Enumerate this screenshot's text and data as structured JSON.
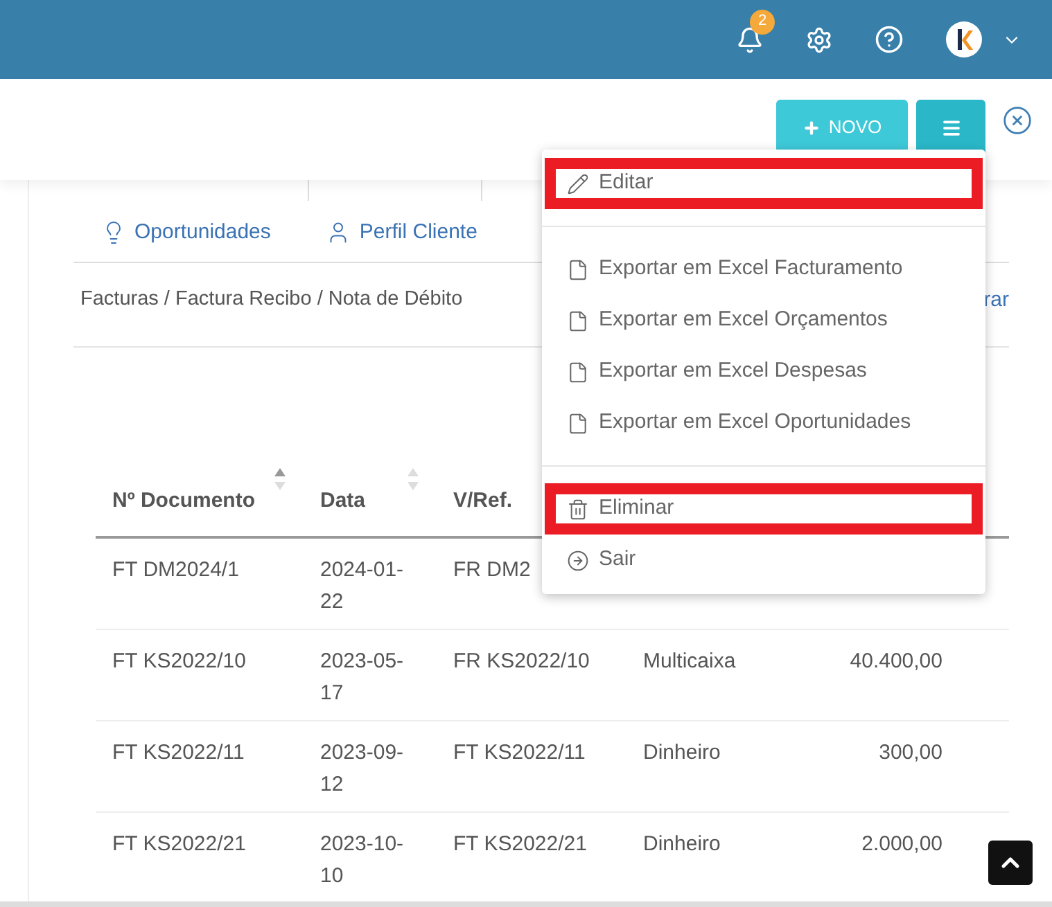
{
  "header": {
    "notification_count": "2"
  },
  "toolbar": {
    "new_button": "NOVO"
  },
  "tabs": [
    {
      "label": "Oportunidades"
    },
    {
      "label": "Perfil Cliente"
    }
  ],
  "breadcrumb": "Facturas / Factura Recibo / Nota de Débito",
  "side_link": "rar",
  "table": {
    "columns": [
      {
        "label": "Nº Documento",
        "sortable": true,
        "sorted": true
      },
      {
        "label": "Data",
        "sortable": true,
        "sorted": false
      },
      {
        "label": "V/Ref.",
        "sortable": false
      }
    ],
    "rows": [
      [
        "FT DM2024/1",
        "2024-01-22",
        "FR DM2"
      ],
      [
        "FT KS2022/10",
        "2023-05-17",
        "FR KS2022/10",
        "Multicaixa",
        "40.400,00"
      ],
      [
        "FT KS2022/11",
        "2023-09-12",
        "FT KS2022/11",
        "Dinheiro",
        "300,00"
      ],
      [
        "FT KS2022/21",
        "2023-10-10",
        "FT KS2022/21",
        "Dinheiro",
        "2.000,00"
      ]
    ]
  },
  "menu": {
    "items": [
      {
        "kind": "edit",
        "label": "Editar",
        "highlighted": true
      },
      {
        "kind": "divider"
      },
      {
        "kind": "export",
        "label": "Exportar em Excel Facturamento",
        "highlighted": false
      },
      {
        "kind": "export",
        "label": "Exportar em Excel Orçamentos",
        "highlighted": false
      },
      {
        "kind": "export",
        "label": "Exportar em Excel Despesas",
        "highlighted": false
      },
      {
        "kind": "export",
        "label": "Exportar em Excel Oportunidades",
        "highlighted": false
      },
      {
        "kind": "divider"
      },
      {
        "kind": "delete",
        "label": "Eliminar",
        "highlighted": true
      },
      {
        "kind": "exit",
        "label": "Sair",
        "highlighted": false
      }
    ]
  }
}
